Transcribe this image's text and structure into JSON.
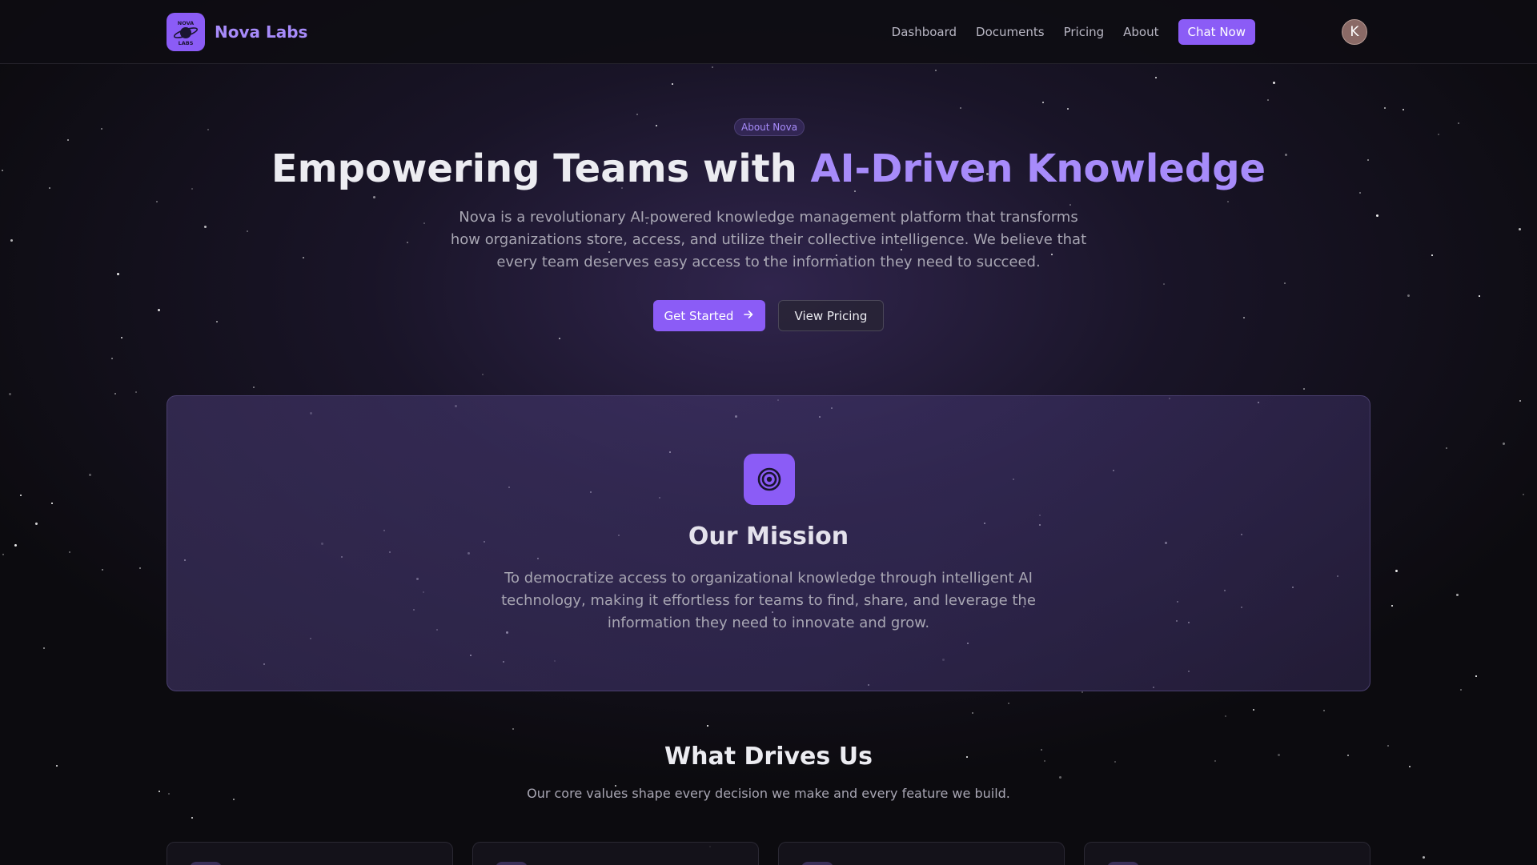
{
  "navbar": {
    "brand_name": "Nova Labs",
    "logo_text_top": "NOVA",
    "logo_text_bottom": "LABS",
    "links": [
      "Dashboard",
      "Documents",
      "Pricing",
      "About"
    ],
    "cta_label": "Chat Now",
    "avatar_initial": "K"
  },
  "hero": {
    "badge": "About Nova",
    "title_plain": "Empowering Teams with ",
    "title_accent": "AI-Driven Knowledge",
    "description": "Nova is a revolutionary AI-powered knowledge management platform that transforms how organizations store, access, and utilize their collective intelligence. We believe that every team deserves easy access to the information they need to succeed.",
    "primary_button": "Get Started",
    "secondary_button": "View Pricing"
  },
  "mission": {
    "title": "Our Mission",
    "text": "To democratize access to organizational knowledge through intelligent AI technology, making it effortless for teams to find, share, and leverage the information they need to innovate and grow."
  },
  "values": {
    "title": "What Drives Us",
    "subtitle": "Our core values shape every decision we make and every feature we build."
  },
  "icons": {
    "logo": "planet-logo-icon",
    "primary_button_icon": "arrow-right-icon",
    "mission_icon": "target-icon"
  },
  "colors": {
    "accent": "#8b5cf6",
    "accent_text": "#a78bfa",
    "background": "#0c0b0f"
  }
}
